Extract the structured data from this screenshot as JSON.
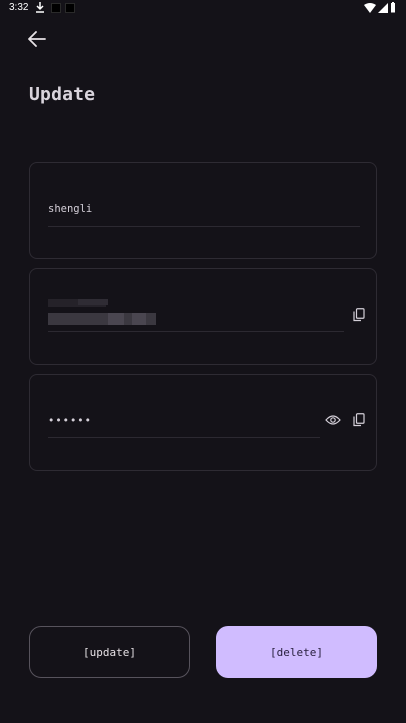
{
  "status_bar": {
    "time": "3:32"
  },
  "header": {
    "title": "Update"
  },
  "fields": {
    "username": {
      "value": "shengli"
    },
    "password": {
      "value": "••••••"
    }
  },
  "actions": {
    "update_label": "[update]",
    "delete_label": "[delete]"
  },
  "colors": {
    "background": "#141218",
    "accent": "#d0bcff",
    "border": "#2e2b33"
  }
}
